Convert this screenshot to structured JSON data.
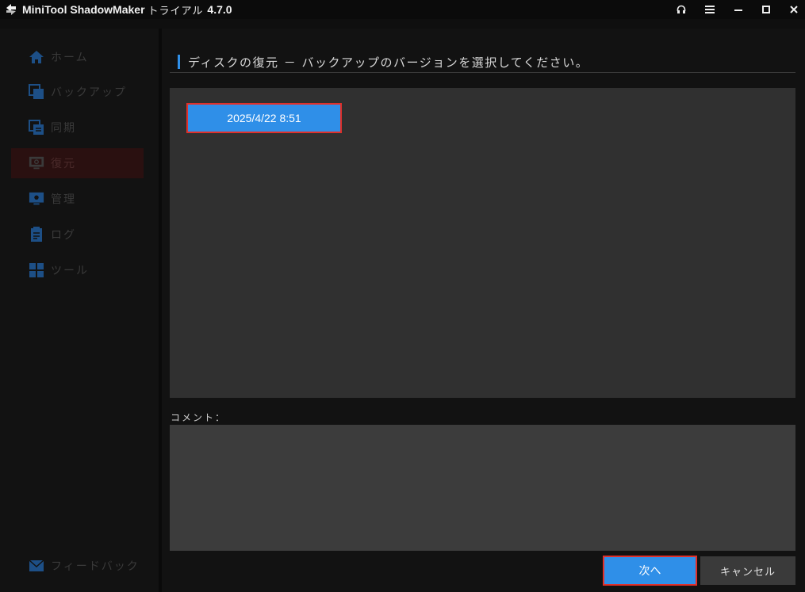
{
  "titlebar": {
    "app_name": "MiniTool ShadowMaker",
    "trial": "トライアル",
    "version": "4.7.0",
    "icons": [
      "headset-icon",
      "menu-icon",
      "minimize-icon",
      "maximize-icon",
      "close-icon"
    ]
  },
  "sidebar": {
    "items": [
      {
        "label": "ホーム",
        "icon": "home-icon",
        "active": false
      },
      {
        "label": "バックアップ",
        "icon": "backup-icon",
        "active": false
      },
      {
        "label": "同期",
        "icon": "sync-icon",
        "active": false
      },
      {
        "label": "復元",
        "icon": "restore-icon",
        "active": true
      },
      {
        "label": "管理",
        "icon": "manage-icon",
        "active": false
      },
      {
        "label": "ログ",
        "icon": "log-icon",
        "active": false
      },
      {
        "label": "ツール",
        "icon": "tools-icon",
        "active": false
      }
    ],
    "feedback": {
      "label": "フィードバック",
      "icon": "mail-icon"
    }
  },
  "main": {
    "heading": "ディスクの復元 － バックアップのバージョンを選択してください。",
    "versions": [
      {
        "label": "2025/4/22 8:51",
        "selected": true
      }
    ],
    "comment_label": "コメント：",
    "comment_value": "",
    "next_label": "次へ",
    "cancel_label": "キャンセル"
  },
  "colors": {
    "accent": "#2f8fe8",
    "highlight_border": "#e0302a",
    "background": "#121212",
    "panel": "#303030"
  }
}
